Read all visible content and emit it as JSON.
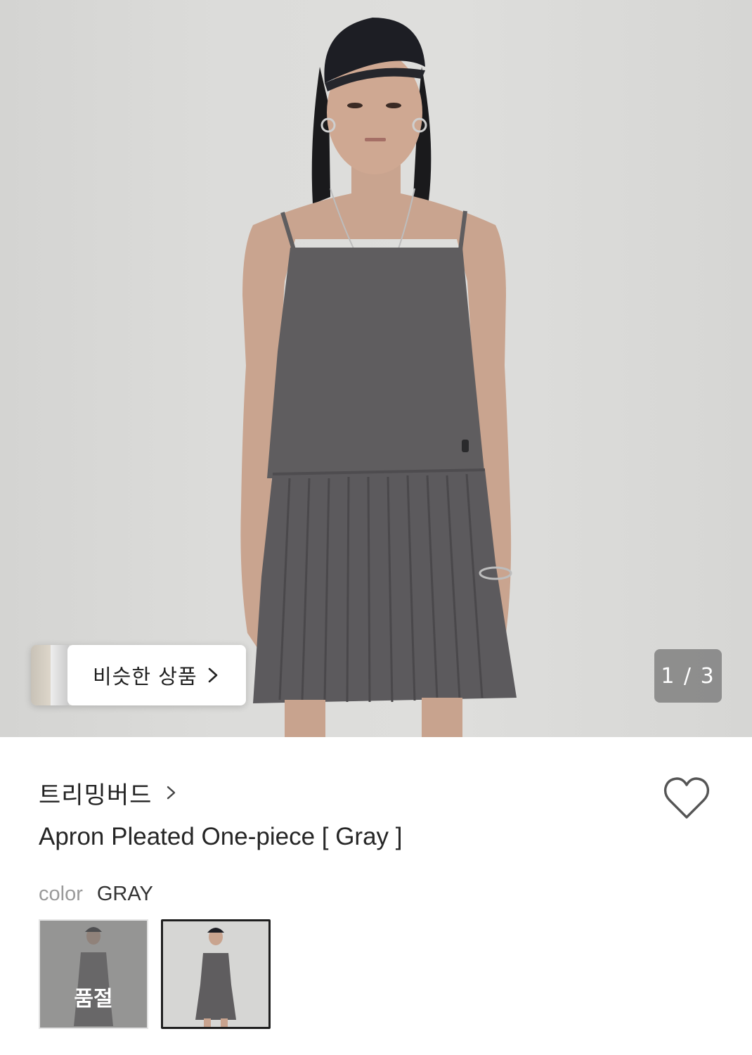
{
  "gallery": {
    "similar_label": "비슷한 상품",
    "counter": "1 / 3"
  },
  "product": {
    "brand": "트리밍버드",
    "title": "Apron Pleated One-piece [ Gray ]"
  },
  "options": {
    "color_key": "color",
    "color_value": "GRAY",
    "swatches": [
      {
        "status": "품절",
        "selected": false
      },
      {
        "status": "",
        "selected": true
      }
    ]
  },
  "colors": {
    "dress": "#5f5d5f",
    "background": "#dcdcda",
    "accent_dark": "#1e1e1e"
  },
  "icons": [
    "chevron-right-icon",
    "heart-icon"
  ]
}
